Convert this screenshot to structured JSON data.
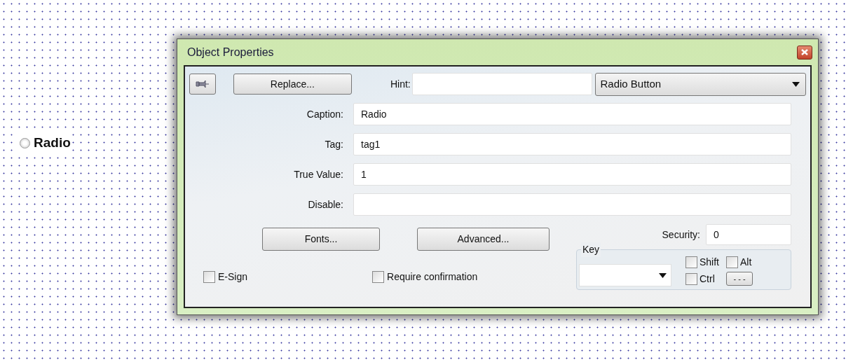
{
  "canvas": {
    "radio": {
      "label": "Radio",
      "selected": false
    }
  },
  "dialog": {
    "title": "Object Properties",
    "replace_button": "Replace...",
    "hint": {
      "label": "Hint:"
    },
    "type_dropdown": {
      "value": "Radio Button"
    },
    "fields": [
      {
        "label": "Caption:",
        "value": "Radio"
      },
      {
        "label": "Tag:",
        "value": "tag1"
      },
      {
        "label": "True Value:",
        "value": "1"
      },
      {
        "label": "Disable:"
      }
    ],
    "fonts_button": "Fonts...",
    "advanced_button": "Advanced...",
    "security": {
      "label": "Security:",
      "value": "0"
    },
    "key": {
      "legend": "Key",
      "modifiers": [
        {
          "label": "Shift",
          "checked": false
        },
        {
          "label": "Alt",
          "checked": false
        },
        {
          "label": "Ctrl",
          "checked": false
        }
      ],
      "more_button": "- - -"
    },
    "checkboxes": [
      {
        "label": "E-Sign",
        "checked": false
      },
      {
        "label": "Require confirmation",
        "checked": false
      }
    ]
  }
}
